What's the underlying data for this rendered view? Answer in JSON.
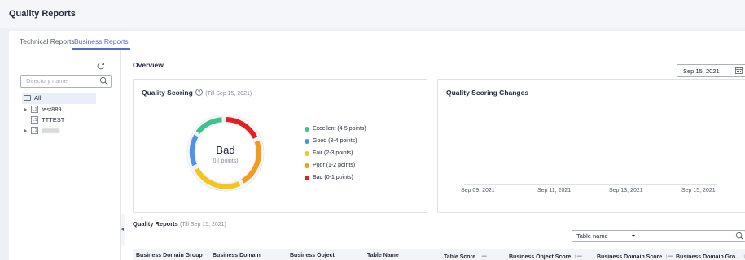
{
  "app": {
    "title": "Quality Reports"
  },
  "tabs": [
    {
      "label": "Technical Reports",
      "active": false
    },
    {
      "label": "Business Reports",
      "active": true
    }
  ],
  "sidebar": {
    "search_placeholder": "Directory name",
    "tree": [
      {
        "label": "All",
        "type": "root",
        "selected": true
      },
      {
        "label": "test889",
        "level": "L1",
        "expandable": true
      },
      {
        "label": "TTTEST",
        "level": "L1",
        "expandable": false
      },
      {
        "label": "",
        "level": "L1",
        "expandable": true,
        "blurred": true
      }
    ]
  },
  "overview": {
    "title": "Overview",
    "date": "Sep 15, 2021"
  },
  "quality_scoring": {
    "title": "Quality Scoring",
    "subtitle": "(Till Sep 15, 2021)",
    "rating": "Bad",
    "points": "0 ( points)",
    "legend": [
      {
        "label": "Excellent (4-5 points)",
        "color": "#3fc28f"
      },
      {
        "label": "Good (3-4 points)",
        "color": "#4c94e8"
      },
      {
        "label": "Fair (2-3 points)",
        "color": "#f5c518"
      },
      {
        "label": "Poor (1-2 points)",
        "color": "#f59b19"
      },
      {
        "label": "Bad (0-1 points)",
        "color": "#e41f1f"
      }
    ]
  },
  "scoring_changes": {
    "title": "Quality Scoring Changes",
    "x_labels": [
      "Sep 09, 2021",
      "Sep 11, 2021",
      "Sep 13, 2021",
      "Sep 15, 2021"
    ]
  },
  "quality_reports": {
    "title": "Quality Reports",
    "subtitle": "(Till Sep 15, 2021)",
    "filter_select": "Table name",
    "columns": [
      {
        "label": "Business Domain Group",
        "sortable": false
      },
      {
        "label": "Business Domain",
        "sortable": false
      },
      {
        "label": "Business Object",
        "sortable": false
      },
      {
        "label": "Table Name",
        "sortable": false
      },
      {
        "label": "Table Score",
        "sortable": true
      },
      {
        "label": "Business Object Score",
        "sortable": true
      },
      {
        "label": "Business Domain Score",
        "sortable": true
      },
      {
        "label": "Business Domain Gro...",
        "sortable": true
      }
    ]
  }
}
